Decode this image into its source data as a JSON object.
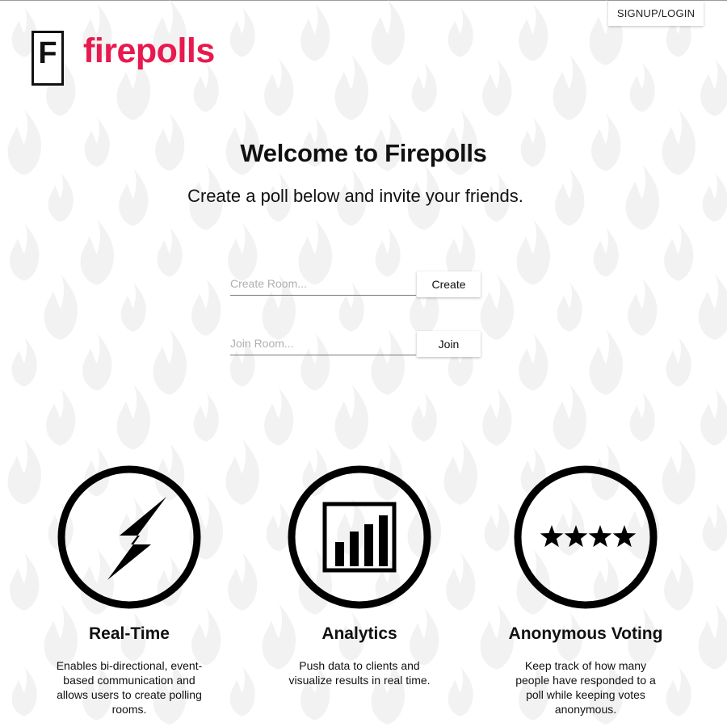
{
  "header": {
    "signup_login_label": "SIGNUP/LOGIN",
    "logo_letter": "F",
    "brand_name": "firepolls"
  },
  "hero": {
    "title": "Welcome to Firepolls",
    "subtitle": "Create a poll below and invite your friends."
  },
  "create_room": {
    "placeholder": "Create Room...",
    "button_label": "Create"
  },
  "join_room": {
    "placeholder": "Join Room...",
    "button_label": "Join"
  },
  "features": [
    {
      "icon": "lightning-bolt-icon",
      "title": "Real-Time",
      "description": "Enables bi-directional, event-based communication and allows users to create polling rooms."
    },
    {
      "icon": "bar-chart-icon",
      "title": "Analytics",
      "description": "Push data to clients and visualize results in real time."
    },
    {
      "icon": "stars-icon",
      "title": "Anonymous Voting",
      "description": "Keep track of how many people have responded to a poll while keeping votes anonymous."
    }
  ],
  "colors": {
    "brand": "#e8194f",
    "background_flame": "#f3f3f3",
    "text": "#111111"
  },
  "background_pattern_icon": "flame-icon"
}
